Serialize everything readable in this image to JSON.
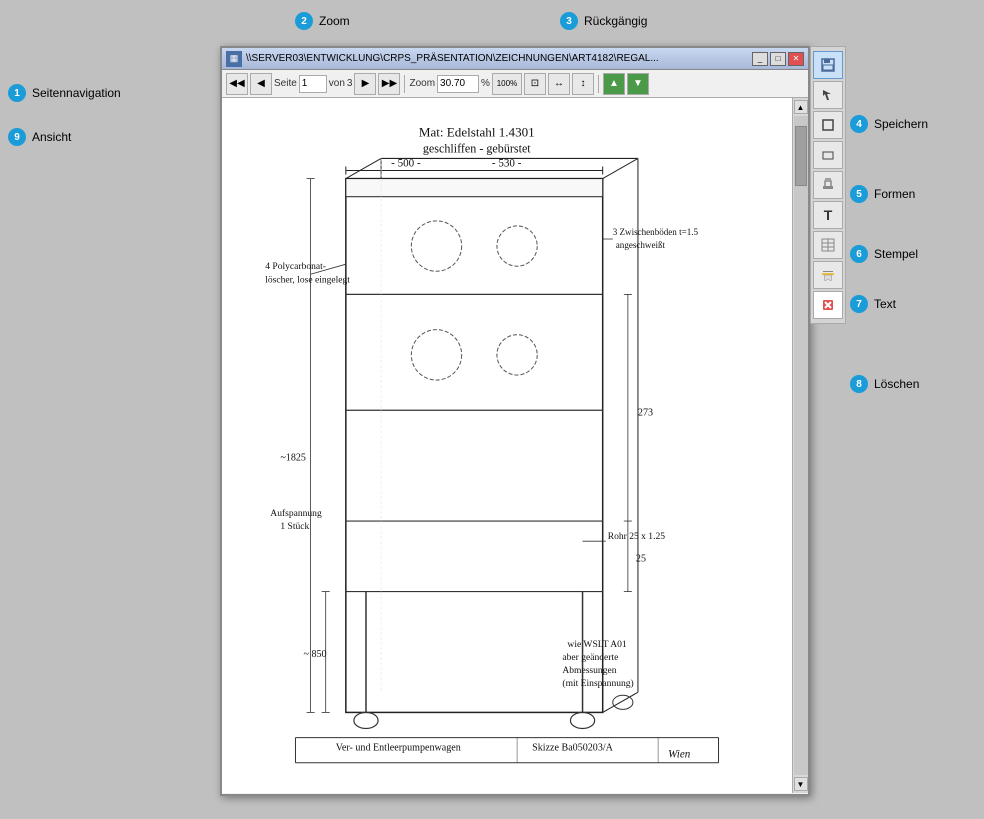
{
  "window": {
    "title": "\\\\SERVER03\\ENTWICKLUNG\\CRPS_PRÄSENTATION\\ZEICHNUNGEN\\ART4182\\REGAL...",
    "title_icon": "doc"
  },
  "toolbar": {
    "page_label": "Seite",
    "page_current": "1",
    "page_separator": "von",
    "page_total": "3",
    "zoom_label": "Zoom",
    "zoom_value": "30.70",
    "zoom_percent": "%",
    "zoom_100": "100%"
  },
  "callouts": {
    "zoom_label": "Zoom",
    "zoom_number": "2",
    "rueckgaengig_label": "Rückgängig",
    "rueckgaengig_number": "3",
    "seitennavigation_label": "Seitennavigation",
    "seitennavigation_number": "1",
    "ansicht_label": "Ansicht",
    "ansicht_number": "9",
    "speichern_label": "Speichern",
    "speichern_number": "4",
    "formen_label": "Formen",
    "formen_number": "5",
    "stempel_label": "Stempel",
    "stempel_number": "6",
    "text_label": "Text",
    "text_number": "7",
    "loeschen_label": "Löschen",
    "loeschen_number": "8"
  },
  "right_buttons": [
    {
      "id": "save",
      "icon": "💾",
      "tooltip": "Speichern"
    },
    {
      "id": "arrow",
      "icon": "↖",
      "tooltip": "Pfeil"
    },
    {
      "id": "select",
      "icon": "◻",
      "tooltip": "Auswählen"
    },
    {
      "id": "rect",
      "icon": "□",
      "tooltip": "Rechteck"
    },
    {
      "id": "stamp",
      "icon": "🔖",
      "tooltip": "Stempel"
    },
    {
      "id": "text",
      "icon": "T",
      "tooltip": "Text"
    },
    {
      "id": "table",
      "icon": "▦",
      "tooltip": "Tabelle"
    },
    {
      "id": "highlight",
      "icon": "☰",
      "tooltip": "Markieren"
    },
    {
      "id": "delete",
      "icon": "✕",
      "tooltip": "Löschen"
    }
  ]
}
